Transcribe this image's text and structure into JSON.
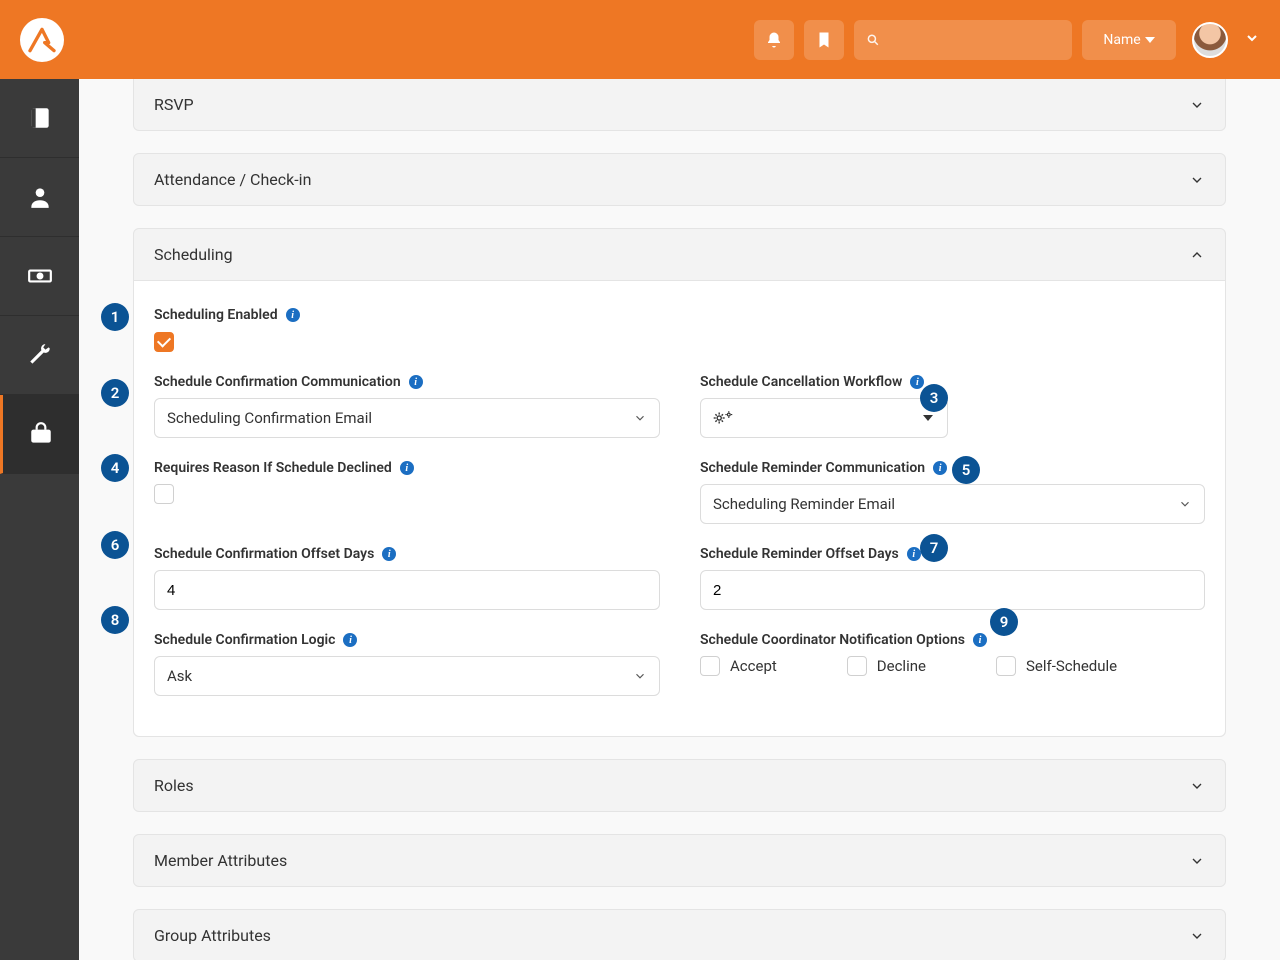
{
  "topbar": {
    "name_label": "Name"
  },
  "panels": {
    "rsvp": "RSVP",
    "attendance": "Attendance / Check-in",
    "scheduling": "Scheduling",
    "roles": "Roles",
    "member_attributes": "Member Attributes",
    "group_attributes": "Group Attributes"
  },
  "scheduling": {
    "enabled_label": "Scheduling Enabled",
    "enabled_checked": true,
    "confirm_comm_label": "Schedule Confirmation Communication",
    "confirm_comm_value": "Scheduling Confirmation Email",
    "cancel_wf_label": "Schedule Cancellation Workflow",
    "requires_reason_label": "Requires Reason If Schedule Declined",
    "requires_reason_checked": false,
    "reminder_comm_label": "Schedule Reminder Communication",
    "reminder_comm_value": "Scheduling Reminder Email",
    "confirm_offset_label": "Schedule Confirmation Offset Days",
    "confirm_offset_value": "4",
    "reminder_offset_label": "Schedule Reminder Offset Days",
    "reminder_offset_value": "2",
    "confirm_logic_label": "Schedule Confirmation Logic",
    "confirm_logic_value": "Ask",
    "coord_notify_label": "Schedule Coordinator Notification Options",
    "coord_accept": "Accept",
    "coord_decline": "Decline",
    "coord_self": "Self-Schedule"
  },
  "callouts": [
    "1",
    "2",
    "3",
    "4",
    "5",
    "6",
    "7",
    "8",
    "9"
  ]
}
